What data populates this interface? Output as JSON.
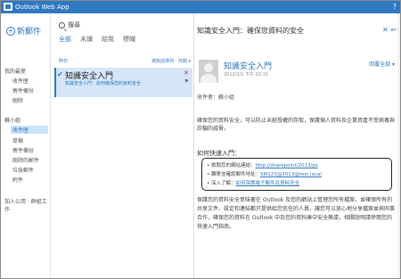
{
  "app": {
    "title": "Outlook Web App",
    "help_glyph": "?"
  },
  "nav": {
    "new_mail": "新郵件",
    "sections": [
      {
        "label": "我的最愛",
        "items": [
          "收件匣",
          "寄件備份",
          "刪除"
        ]
      },
      {
        "label": "蘇小姐",
        "items": [
          "收件匣",
          "草稿",
          "寄件備份",
          "刪除的郵件",
          "垃圾郵件",
          "附件"
        ]
      }
    ],
    "footer": "加入公用 · 群組工作"
  },
  "list": {
    "search_label": "搜尋",
    "filters": [
      "全部",
      "未讀",
      "給我",
      "標幟"
    ],
    "group": "昨日",
    "sort": "按對話排列 · 日期 ▾",
    "message": {
      "sender": "知識安全入門",
      "preview": "知識安全人門：如何確保您的資料安全",
      "close": "✕",
      "flag": "⚑"
    }
  },
  "reading": {
    "subject": "知識安全入門：確保您資料的安全",
    "subject_actions": "✕ ↩",
    "from": "知識安全入門",
    "date": "2012/3/1 下午 02:15",
    "reply_all": "回覆全部 ▾",
    "to_line": "收件者：蘇小姐",
    "para1": "確保您的資料安全，可以防止未經授權的存取，保護個人資料及企業資產不受病毒與詐騙的威脅。",
    "how_title": "如何快速入門：",
    "bullets": [
      {
        "text": "檢閱您的網站連結：",
        "link": "http://sharepoint/2013/ps"
      },
      {
        "text": "轉寄並確認郵件地址：",
        "link": "SM123@2013@test.local"
      },
      {
        "text": "深入了解：",
        "link": "如何保護電子郵件及資料安全"
      }
    ],
    "para2": "保護您的資料安全意味著在 Outlook 及您的網站上管理您所有檔案，並確保所有的共享文件、設定和連結都只提供給您信任的人員，讓您可以放心地分享檔案並與同事合作，確保您的資料在 Outlook 中及您的資料庫中安全無虞，相關說明請參閱您的快速入門指南。"
  }
}
